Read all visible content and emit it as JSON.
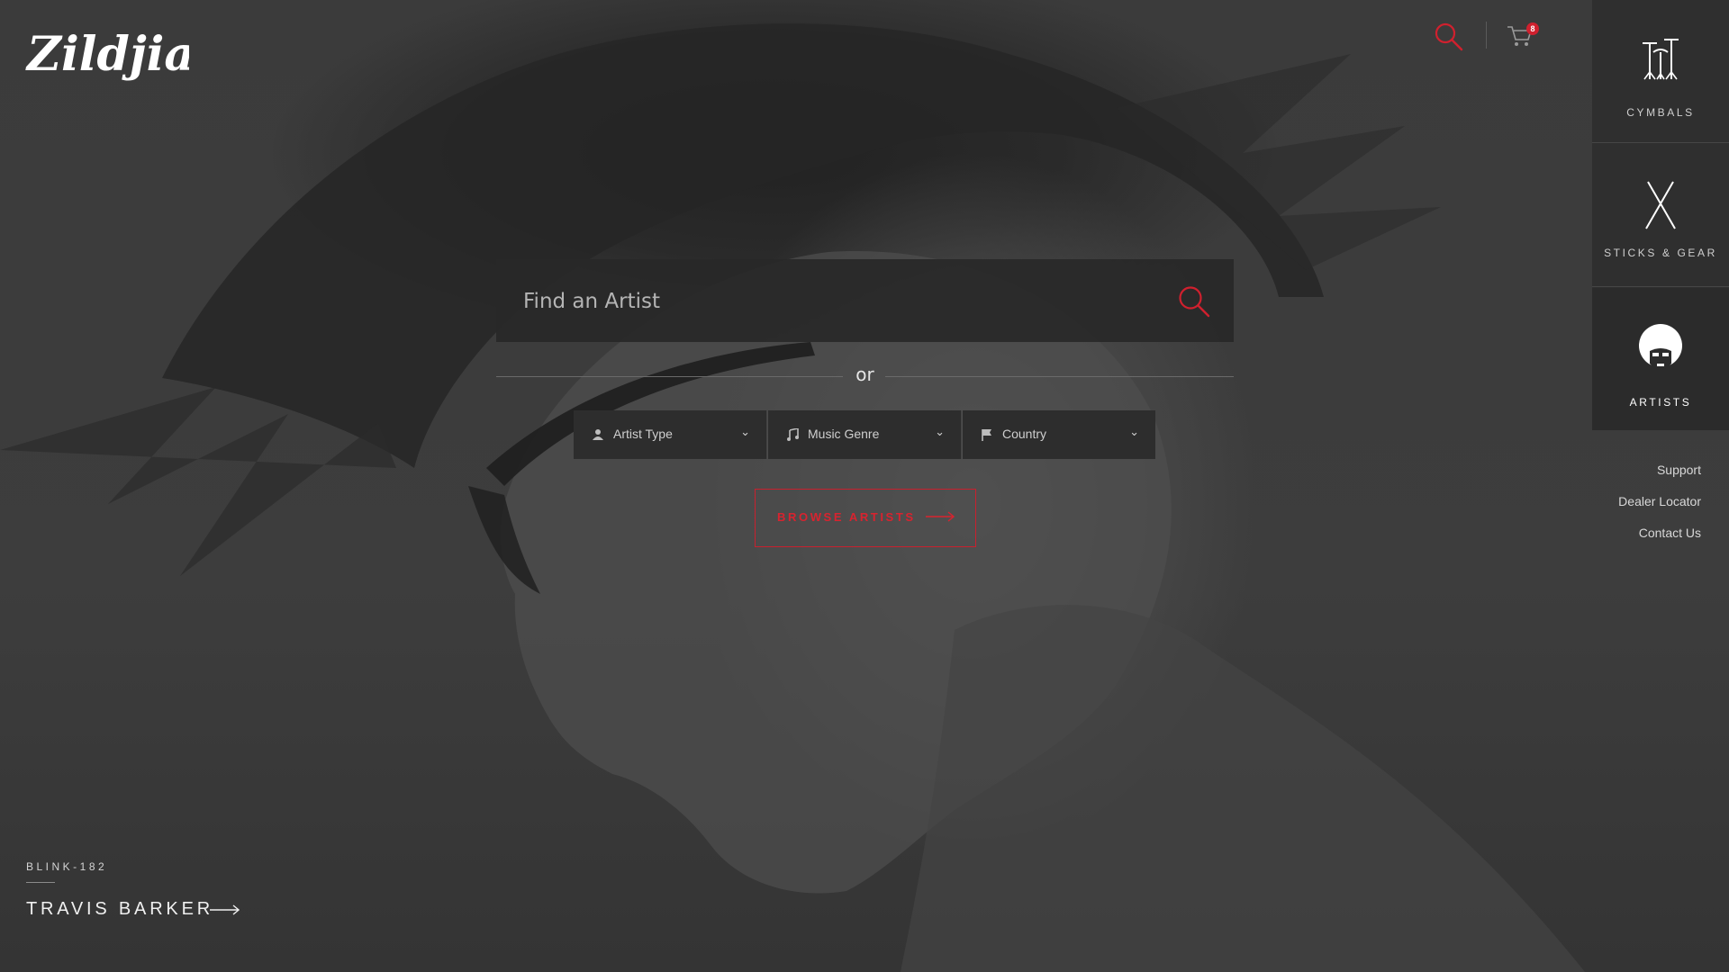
{
  "brand": {
    "logo_text": "Zildjian",
    "accent": "#d0202e"
  },
  "header": {
    "search_icon": "search-icon",
    "cart_icon": "cart-icon",
    "cart_count": "8"
  },
  "side_nav": {
    "items": [
      {
        "label": "CYMBALS",
        "icon": "cymbals-icon"
      },
      {
        "label": "STICKS & GEAR",
        "icon": "sticks-icon"
      },
      {
        "label": "ARTISTS",
        "icon": "artist-afro-icon"
      }
    ],
    "active": "ARTISTS"
  },
  "utility_links": [
    "Support",
    "Dealer Locator",
    "Contact Us"
  ],
  "search": {
    "placeholder": "Find an Artist",
    "value": ""
  },
  "separator": "or",
  "filters": [
    {
      "label": "Artist Type",
      "icon": "person-icon"
    },
    {
      "label": "Music Genre",
      "icon": "music-note-icon"
    },
    {
      "label": "Country",
      "icon": "flag-icon"
    }
  ],
  "browse_button": "BROWSE ARTISTS",
  "featured": {
    "band": "BLINK-182",
    "name": "TRAVIS BARKER"
  }
}
